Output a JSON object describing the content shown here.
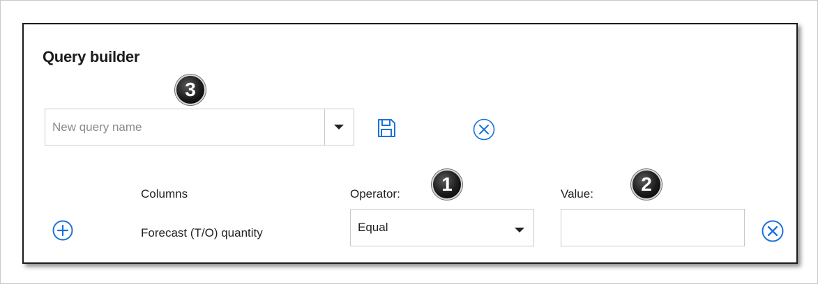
{
  "dialog": {
    "title": "Query builder"
  },
  "query": {
    "placeholder": "New query name"
  },
  "icons": {
    "save": "save-icon",
    "clear": "clear-circle-x-icon",
    "add": "add-circle-plus-icon",
    "remove": "remove-circle-x-icon",
    "accent_color": "#1a73d9"
  },
  "callouts": {
    "one": "1",
    "two": "2",
    "three": "3"
  },
  "filter": {
    "columns_label": "Columns",
    "operator_label": "Operator:",
    "value_label": "Value:",
    "column_value": "Forecast (T/O) quantity",
    "operator_value": "Equal",
    "value_value": ""
  }
}
